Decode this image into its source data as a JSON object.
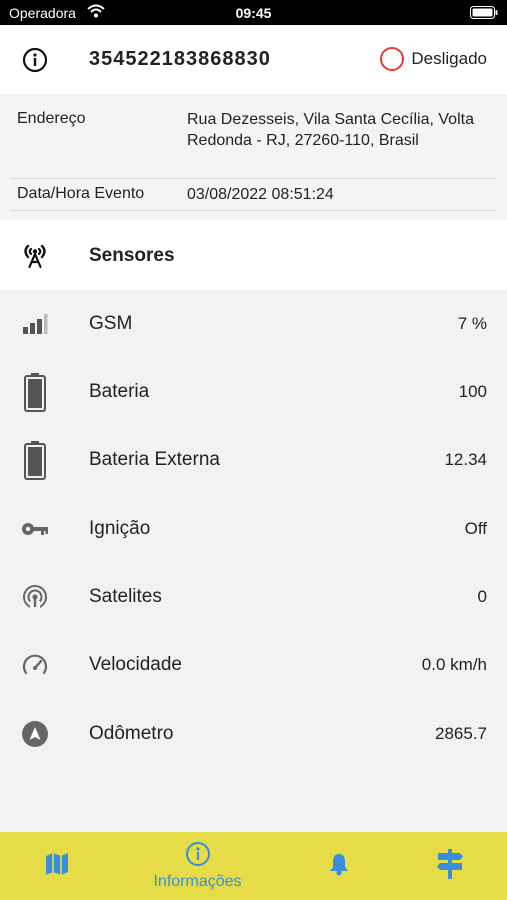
{
  "status_bar": {
    "carrier": "Operadora",
    "time": "09:45"
  },
  "header": {
    "device_id": "354522183868830",
    "status": "Desligado"
  },
  "details": {
    "address_label": "Endereço",
    "address_value": "Rua Dezesseis, Vila Santa Cecília, Volta Redonda - RJ, 27260-110, Brasil",
    "datetime_label": "Data/Hora Evento",
    "datetime_value": "03/08/2022 08:51:24"
  },
  "sensors": {
    "title": "Sensores",
    "items": [
      {
        "name": "GSM",
        "value": "7 %",
        "icon": "signal-bars-icon"
      },
      {
        "name": "Bateria",
        "value": "100",
        "icon": "battery-icon"
      },
      {
        "name": "Bateria Externa",
        "value": "12.34",
        "icon": "battery-icon"
      },
      {
        "name": "Ignição",
        "value": "Off",
        "icon": "key-icon"
      },
      {
        "name": "Satelites",
        "value": "0",
        "icon": "satellite-icon"
      },
      {
        "name": "Velocidade",
        "value": "0.0 km/h",
        "icon": "speedometer-icon"
      },
      {
        "name": "Odômetro",
        "value": "2865.7",
        "icon": "navigation-arrow-icon"
      }
    ]
  },
  "tab_bar": {
    "active_label": "Informações",
    "tabs": [
      "map-icon",
      "info-icon",
      "bell-icon",
      "signpost-icon"
    ]
  },
  "colors": {
    "accent": "#3a8fdc",
    "tab_bar": "#e5dc48",
    "offline": "#e53935"
  }
}
